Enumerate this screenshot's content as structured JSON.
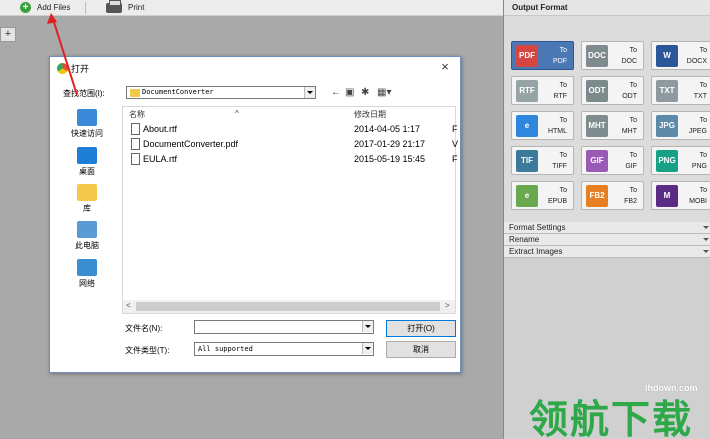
{
  "toolbar": {
    "add_files": "Add Files",
    "print": "Print"
  },
  "tab_strip": {
    "add_symbol": "+"
  },
  "right_panel": {
    "title": "Output Format",
    "formats": [
      {
        "to": "To",
        "name": "PDF",
        "icon": "pdf-icon",
        "color": "#d64541",
        "glyph": "PDF"
      },
      {
        "to": "To",
        "name": "DOC",
        "icon": "doc-icon",
        "color": "#7f8c8d",
        "glyph": "DOC"
      },
      {
        "to": "To",
        "name": "DOCX",
        "icon": "docx-icon",
        "color": "#2b579a",
        "glyph": "W"
      },
      {
        "to": "To",
        "name": "RTF",
        "icon": "rtf-icon",
        "color": "#95a5a6",
        "glyph": "RTF"
      },
      {
        "to": "To",
        "name": "ODT",
        "icon": "odt-icon",
        "color": "#7b8a8b",
        "glyph": "ODT"
      },
      {
        "to": "To",
        "name": "TXT",
        "icon": "txt-icon",
        "color": "#8e9aa0",
        "glyph": "TXT"
      },
      {
        "to": "To",
        "name": "HTML",
        "icon": "html-icon",
        "color": "#2e86de",
        "glyph": "e"
      },
      {
        "to": "To",
        "name": "MHT",
        "icon": "mht-icon",
        "color": "#7f8c8d",
        "glyph": "MHT"
      },
      {
        "to": "To",
        "name": "JPEG",
        "icon": "jpeg-icon",
        "color": "#5d8aa8",
        "glyph": "JPG"
      },
      {
        "to": "To",
        "name": "TIFF",
        "icon": "tiff-icon",
        "color": "#3d7a99",
        "glyph": "TIF"
      },
      {
        "to": "To",
        "name": "GIF",
        "icon": "gif-icon",
        "color": "#9b59b6",
        "glyph": "GIF"
      },
      {
        "to": "To",
        "name": "PNG",
        "icon": "png-icon",
        "color": "#16a085",
        "glyph": "PNG"
      },
      {
        "to": "To",
        "name": "EPUB",
        "icon": "epub-icon",
        "color": "#6aa84f",
        "glyph": "e"
      },
      {
        "to": "To",
        "name": "FB2",
        "icon": "fb2-icon",
        "color": "#e67e22",
        "glyph": "FB2"
      },
      {
        "to": "To",
        "name": "MOBI",
        "icon": "mobi-icon",
        "color": "#5b2c83",
        "glyph": "M"
      }
    ],
    "options": [
      "Format Settings",
      "Rename",
      "Extract Images"
    ]
  },
  "dialog": {
    "title": "打开",
    "close": "×",
    "lookin_label": "查找范围(I):",
    "lookin_value": "DocumentConverter",
    "places": [
      "快速访问",
      "桌面",
      "库",
      "此电脑",
      "网络"
    ],
    "columns": {
      "name": "名称",
      "date": "修改日期"
    },
    "files": [
      {
        "name": "About.rtf",
        "date": "2014-04-05 1:17",
        "cut": "F"
      },
      {
        "name": "DocumentConverter.pdf",
        "date": "2017-01-29 21:17",
        "cut": "V"
      },
      {
        "name": "EULA.rtf",
        "date": "2015-05-19 15:45",
        "cut": "F"
      }
    ],
    "filename_label": "文件名(N):",
    "filename_value": "",
    "filetype_label": "文件类型(T):",
    "filetype_value": "All supported",
    "open_button": "打开(O)",
    "cancel_button": "取消"
  },
  "watermark": {
    "url": "lhdown.com",
    "text": "领航下载"
  }
}
